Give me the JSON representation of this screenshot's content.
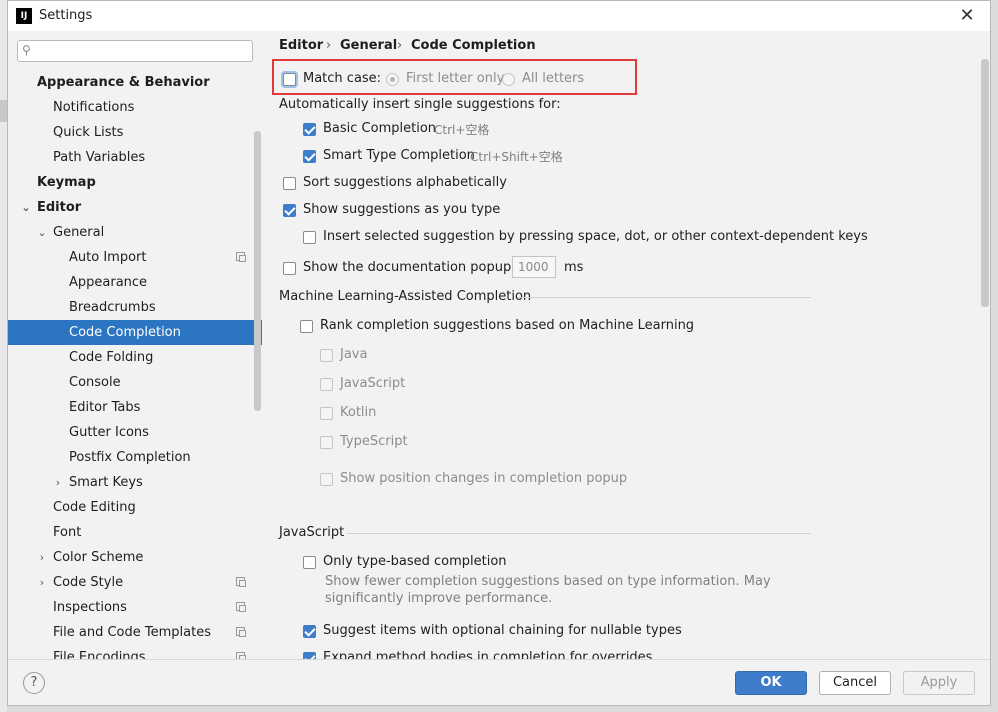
{
  "window": {
    "title": "Settings",
    "app_icon": "IJ"
  },
  "sidebar": {
    "search_placeholder": "",
    "items": [
      {
        "label": "Appearance & Behavior"
      },
      {
        "label": "Notifications"
      },
      {
        "label": "Quick Lists"
      },
      {
        "label": "Path Variables"
      },
      {
        "label": "Keymap"
      },
      {
        "label": "Editor"
      },
      {
        "label": "General"
      },
      {
        "label": "Auto Import"
      },
      {
        "label": "Appearance"
      },
      {
        "label": "Breadcrumbs"
      },
      {
        "label": "Code Completion"
      },
      {
        "label": "Code Folding"
      },
      {
        "label": "Console"
      },
      {
        "label": "Editor Tabs"
      },
      {
        "label": "Gutter Icons"
      },
      {
        "label": "Postfix Completion"
      },
      {
        "label": "Smart Keys"
      },
      {
        "label": "Code Editing"
      },
      {
        "label": "Font"
      },
      {
        "label": "Color Scheme"
      },
      {
        "label": "Code Style"
      },
      {
        "label": "Inspections"
      },
      {
        "label": "File and Code Templates"
      },
      {
        "label": "File Encodings"
      }
    ]
  },
  "breadcrumb": {
    "part1": "Editor",
    "part2": "General",
    "part3": "Code Completion",
    "sep": "›"
  },
  "completion": {
    "match_case": "Match case:",
    "first_letter": "First letter only",
    "all_letters": "All letters",
    "auto_insert_header": "Automatically insert single suggestions for:",
    "basic": "Basic Completion",
    "basic_shortcut": "Ctrl+空格",
    "smart": "Smart Type Completion",
    "smart_shortcut": "Ctrl+Shift+空格",
    "sort_alpha": "Sort suggestions alphabetically",
    "show_as_type": "Show suggestions as you type",
    "insert_selected": "Insert selected suggestion by pressing space, dot, or other context-dependent keys",
    "show_doc": "Show the documentation popup in",
    "doc_ms_value": "1000",
    "ms": "ms"
  },
  "ml": {
    "title": "Machine Learning-Assisted Completion",
    "rank": "Rank completion suggestions based on Machine Learning",
    "java": "Java",
    "javascript": "JavaScript",
    "kotlin": "Kotlin",
    "typescript": "TypeScript",
    "show_position": "Show position changes in completion popup"
  },
  "js": {
    "title": "JavaScript",
    "only_type": "Only type-based completion",
    "only_type_desc_1": "Show fewer completion suggestions based on type information. May",
    "only_type_desc_2": "significantly improve performance.",
    "suggest_optional": "Suggest items with optional chaining for nullable types",
    "expand_method": "Expand method bodies in completion for overrides"
  },
  "footer": {
    "help": "?",
    "ok": "OK",
    "cancel": "Cancel",
    "apply": "Apply"
  },
  "colors": {
    "accent": "#3d7dca",
    "selection": "#2c75c3",
    "highlight": "#e03a3a"
  }
}
